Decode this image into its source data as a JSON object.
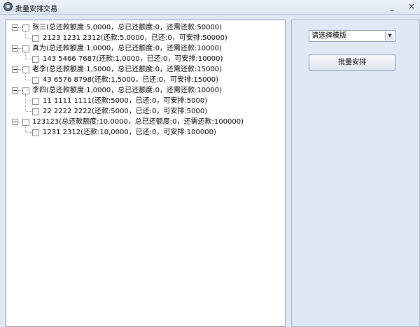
{
  "window": {
    "title": "批量安排交易",
    "minimize_glyph": "_",
    "close_glyph": "×"
  },
  "tree": [
    {
      "label": "张三(总还款额度:5,0000，总已还额度:0，还需还款:50000)",
      "children": [
        {
          "label": "2123 1231 2312(还款:5,0000，已还:0，可安排:50000)"
        }
      ]
    },
    {
      "label": "真为(总还款额度:1,0000，总已还额度:0，还需还款:10000)",
      "children": [
        {
          "label": "143 5466 7687(还款:1,0000，已还:0，可安排:10000)"
        }
      ]
    },
    {
      "label": "老李(总还款额度:1,5000，总已还额度:0，还需还款:15000)",
      "children": [
        {
          "label": "43 6576 8798(还款:1,5000，已还:0，可安排:15000)"
        }
      ]
    },
    {
      "label": "李四(总还款额度:1,0000，总已还额度:0，还需还款:10000)",
      "children": [
        {
          "label": "11 1111 1111(还款:5000，已还:0，可安排:5000)"
        },
        {
          "label": "22 2222 2222(还款:5000，已还:0，可安排:5000)"
        }
      ]
    },
    {
      "label": "123123(总还款额度:10,0000，总已还额度:0，还需还款:100000)",
      "children": [
        {
          "label": "1231 2312(还款:10,0000，已还:0，可安排:100000)"
        }
      ]
    }
  ],
  "template_select": {
    "value": "请选择模版",
    "arrow_icon": "chevron-down-icon"
  },
  "batch_button": {
    "label": "批量安排"
  },
  "colors": {
    "window_bg": "#dfe8f3",
    "panel_bg": "#ffffff",
    "border": "#8e9fb5"
  }
}
